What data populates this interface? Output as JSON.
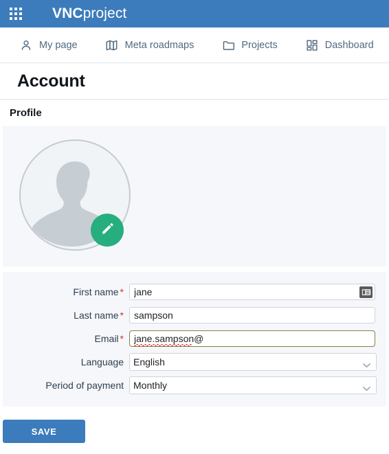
{
  "brand": {
    "app_launcher_icon": "app-grid-icon",
    "name_bold": "VNC",
    "name_light": "project",
    "bar_color": "#3C7CBC"
  },
  "nav": {
    "items": [
      {
        "label": "My page",
        "icon": "person-icon"
      },
      {
        "label": "Meta roadmaps",
        "icon": "map-icon"
      },
      {
        "label": "Projects",
        "icon": "folder-icon"
      },
      {
        "label": "Dashboard",
        "icon": "dashboard-grid-icon"
      }
    ]
  },
  "page": {
    "title": "Account",
    "section_title": "Profile"
  },
  "profile": {
    "avatar_icon": "avatar-placeholder-icon",
    "edit_button_icon": "pencil-icon",
    "edit_button_color": "#27AE7F"
  },
  "form": {
    "fields": [
      {
        "name": "first-name",
        "label": "First name",
        "required": "*",
        "value": "jane",
        "placeholder": "",
        "type": "text",
        "focused": false,
        "has_autofill_icon": true,
        "spellcheck_error": false
      },
      {
        "name": "last-name",
        "label": "Last name",
        "required": "*",
        "value": "sampson",
        "placeholder": "",
        "type": "text",
        "focused": false,
        "has_autofill_icon": false,
        "spellcheck_error": false
      },
      {
        "name": "email",
        "label": "Email",
        "required": "*",
        "value": "jane.sampson@",
        "placeholder": "",
        "type": "text",
        "focused": true,
        "has_autofill_icon": false,
        "spellcheck_error": true
      },
      {
        "name": "language",
        "label": "Language",
        "required": "",
        "value": "English",
        "type": "select",
        "options": [
          "English"
        ]
      },
      {
        "name": "period-of-payment",
        "label": "Period of payment",
        "required": "",
        "value": "Monthly",
        "type": "select",
        "options": [
          "Monthly"
        ]
      }
    ]
  },
  "actions": {
    "save_label": "SAVE",
    "save_color": "#3C7CBC"
  }
}
